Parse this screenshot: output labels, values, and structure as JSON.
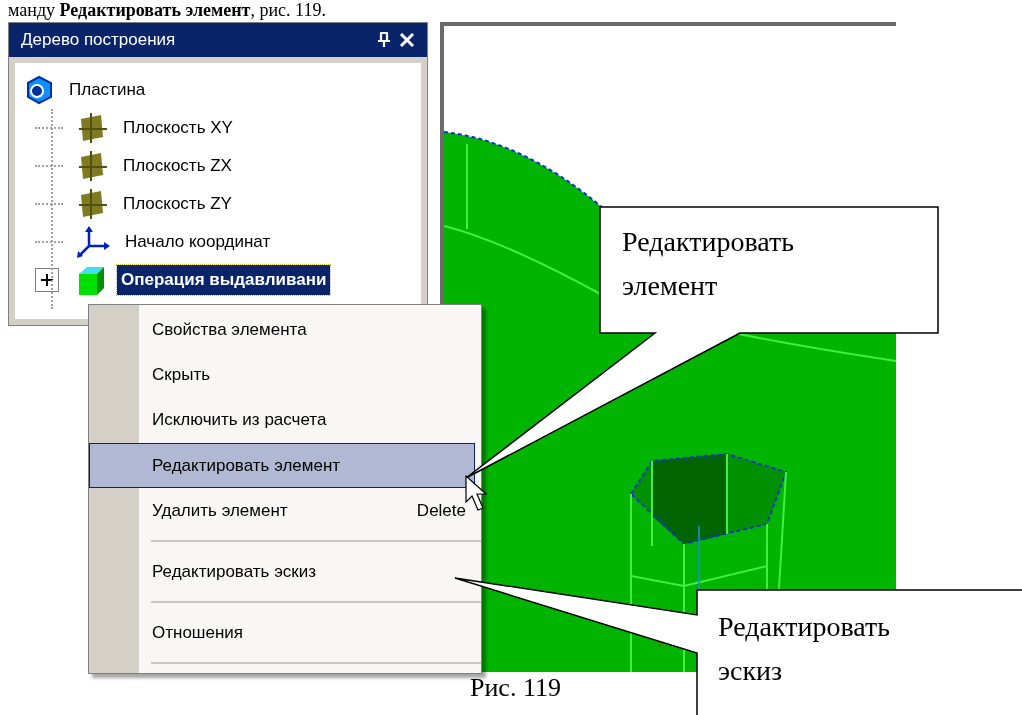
{
  "page_text": "манду **Редактировать элемент**, рис. 119.",
  "panel": {
    "title": "Дерево построения",
    "tree": [
      {
        "label": "Пластина",
        "kind": "part",
        "selected": false,
        "children": [
          {
            "label": "Плоскость XY",
            "kind": "plane",
            "selected": false
          },
          {
            "label": "Плоскость ZX",
            "kind": "plane",
            "selected": false
          },
          {
            "label": "Плоскость ZY",
            "kind": "plane",
            "selected": false
          },
          {
            "label": "Начало координат",
            "kind": "origin",
            "selected": false
          },
          {
            "label": "Операция выдавливани",
            "kind": "extrude",
            "selected": true,
            "expanded": false
          }
        ]
      }
    ]
  },
  "context_menu": [
    {
      "kind": "item",
      "label": "Свойства элемента",
      "selected": false
    },
    {
      "kind": "item",
      "label": "Скрыть",
      "selected": false
    },
    {
      "kind": "item",
      "label": "Исключить из расчета",
      "selected": false
    },
    {
      "kind": "item",
      "label": "Редактировать элемент",
      "selected": true
    },
    {
      "kind": "item",
      "label": "Удалить элемент",
      "shortcut": "Delete",
      "selected": false
    },
    {
      "kind": "separator"
    },
    {
      "kind": "item",
      "label": "Редактировать эскиз",
      "selected": false
    },
    {
      "kind": "separator"
    },
    {
      "kind": "item",
      "label": "Отношения",
      "selected": false
    },
    {
      "kind": "separator"
    }
  ],
  "callouts": [
    {
      "text": "Редактировать элемент"
    },
    {
      "text": "Редактировать эскиз"
    }
  ],
  "caption": "Рис. 119"
}
